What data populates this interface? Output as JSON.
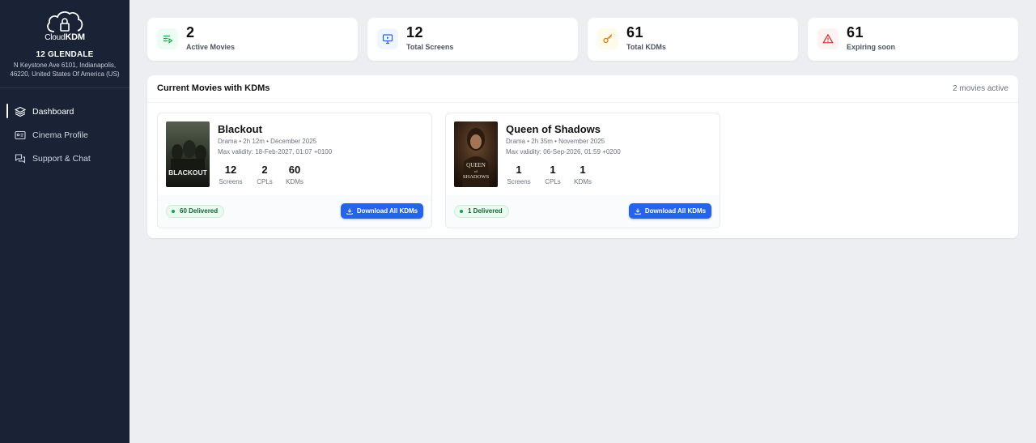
{
  "app": {
    "logo_prefix": "Cloud",
    "logo_suffix": "KDM"
  },
  "cinema": {
    "name": "12 GLENDALE",
    "address": "N Keystone Ave 6101, Indianapolis, 46220, United States Of America (US)"
  },
  "nav": [
    {
      "label": "Dashboard",
      "icon": "layers-icon",
      "active": true
    },
    {
      "label": "Cinema Profile",
      "icon": "id-card-icon",
      "active": false
    },
    {
      "label": "Support & Chat",
      "icon": "chat-icon",
      "active": false
    }
  ],
  "stats": [
    {
      "value": "2",
      "label": "Active Movies",
      "icon": "playlist-icon",
      "color": "#16a34a",
      "bg": "#ecfdf3"
    },
    {
      "value": "12",
      "label": "Total Screens",
      "icon": "monitor-icon",
      "color": "#2563eb",
      "bg": "#eff6ff"
    },
    {
      "value": "61",
      "label": "Total KDMs",
      "icon": "key-icon",
      "color": "#d97706",
      "bg": "#fffbeb"
    },
    {
      "value": "61",
      "label": "Expiring soon",
      "icon": "warning-icon",
      "color": "#dc2626",
      "bg": "#fef2f2"
    }
  ],
  "panel": {
    "title": "Current Movies with KDMs",
    "count": "2 movies active"
  },
  "movies": [
    {
      "title": "Blackout",
      "meta": "Drama • 2h 12m • December 2025",
      "validity": "Max validity: 18-Feb-2027, 01:07 +0100",
      "poster_text": "BLACKOUT",
      "screens": "12",
      "screens_label": "Screens",
      "cpls": "2",
      "cpls_label": "CPLs",
      "kdms": "60",
      "kdms_label": "KDMs",
      "delivered": "60 Delivered",
      "download": "Download All KDMs"
    },
    {
      "title": "Queen of Shadows",
      "meta": "Drama • 2h 35m • November 2025",
      "validity": "Max validity: 06-Sep-2026, 01:59 +0200",
      "poster_text": "QUEEN of SHADOWS",
      "screens": "1",
      "screens_label": "Screens",
      "cpls": "1",
      "cpls_label": "CPLs",
      "kdms": "1",
      "kdms_label": "KDMs",
      "delivered": "1 Delivered",
      "download": "Download All KDMs"
    }
  ]
}
